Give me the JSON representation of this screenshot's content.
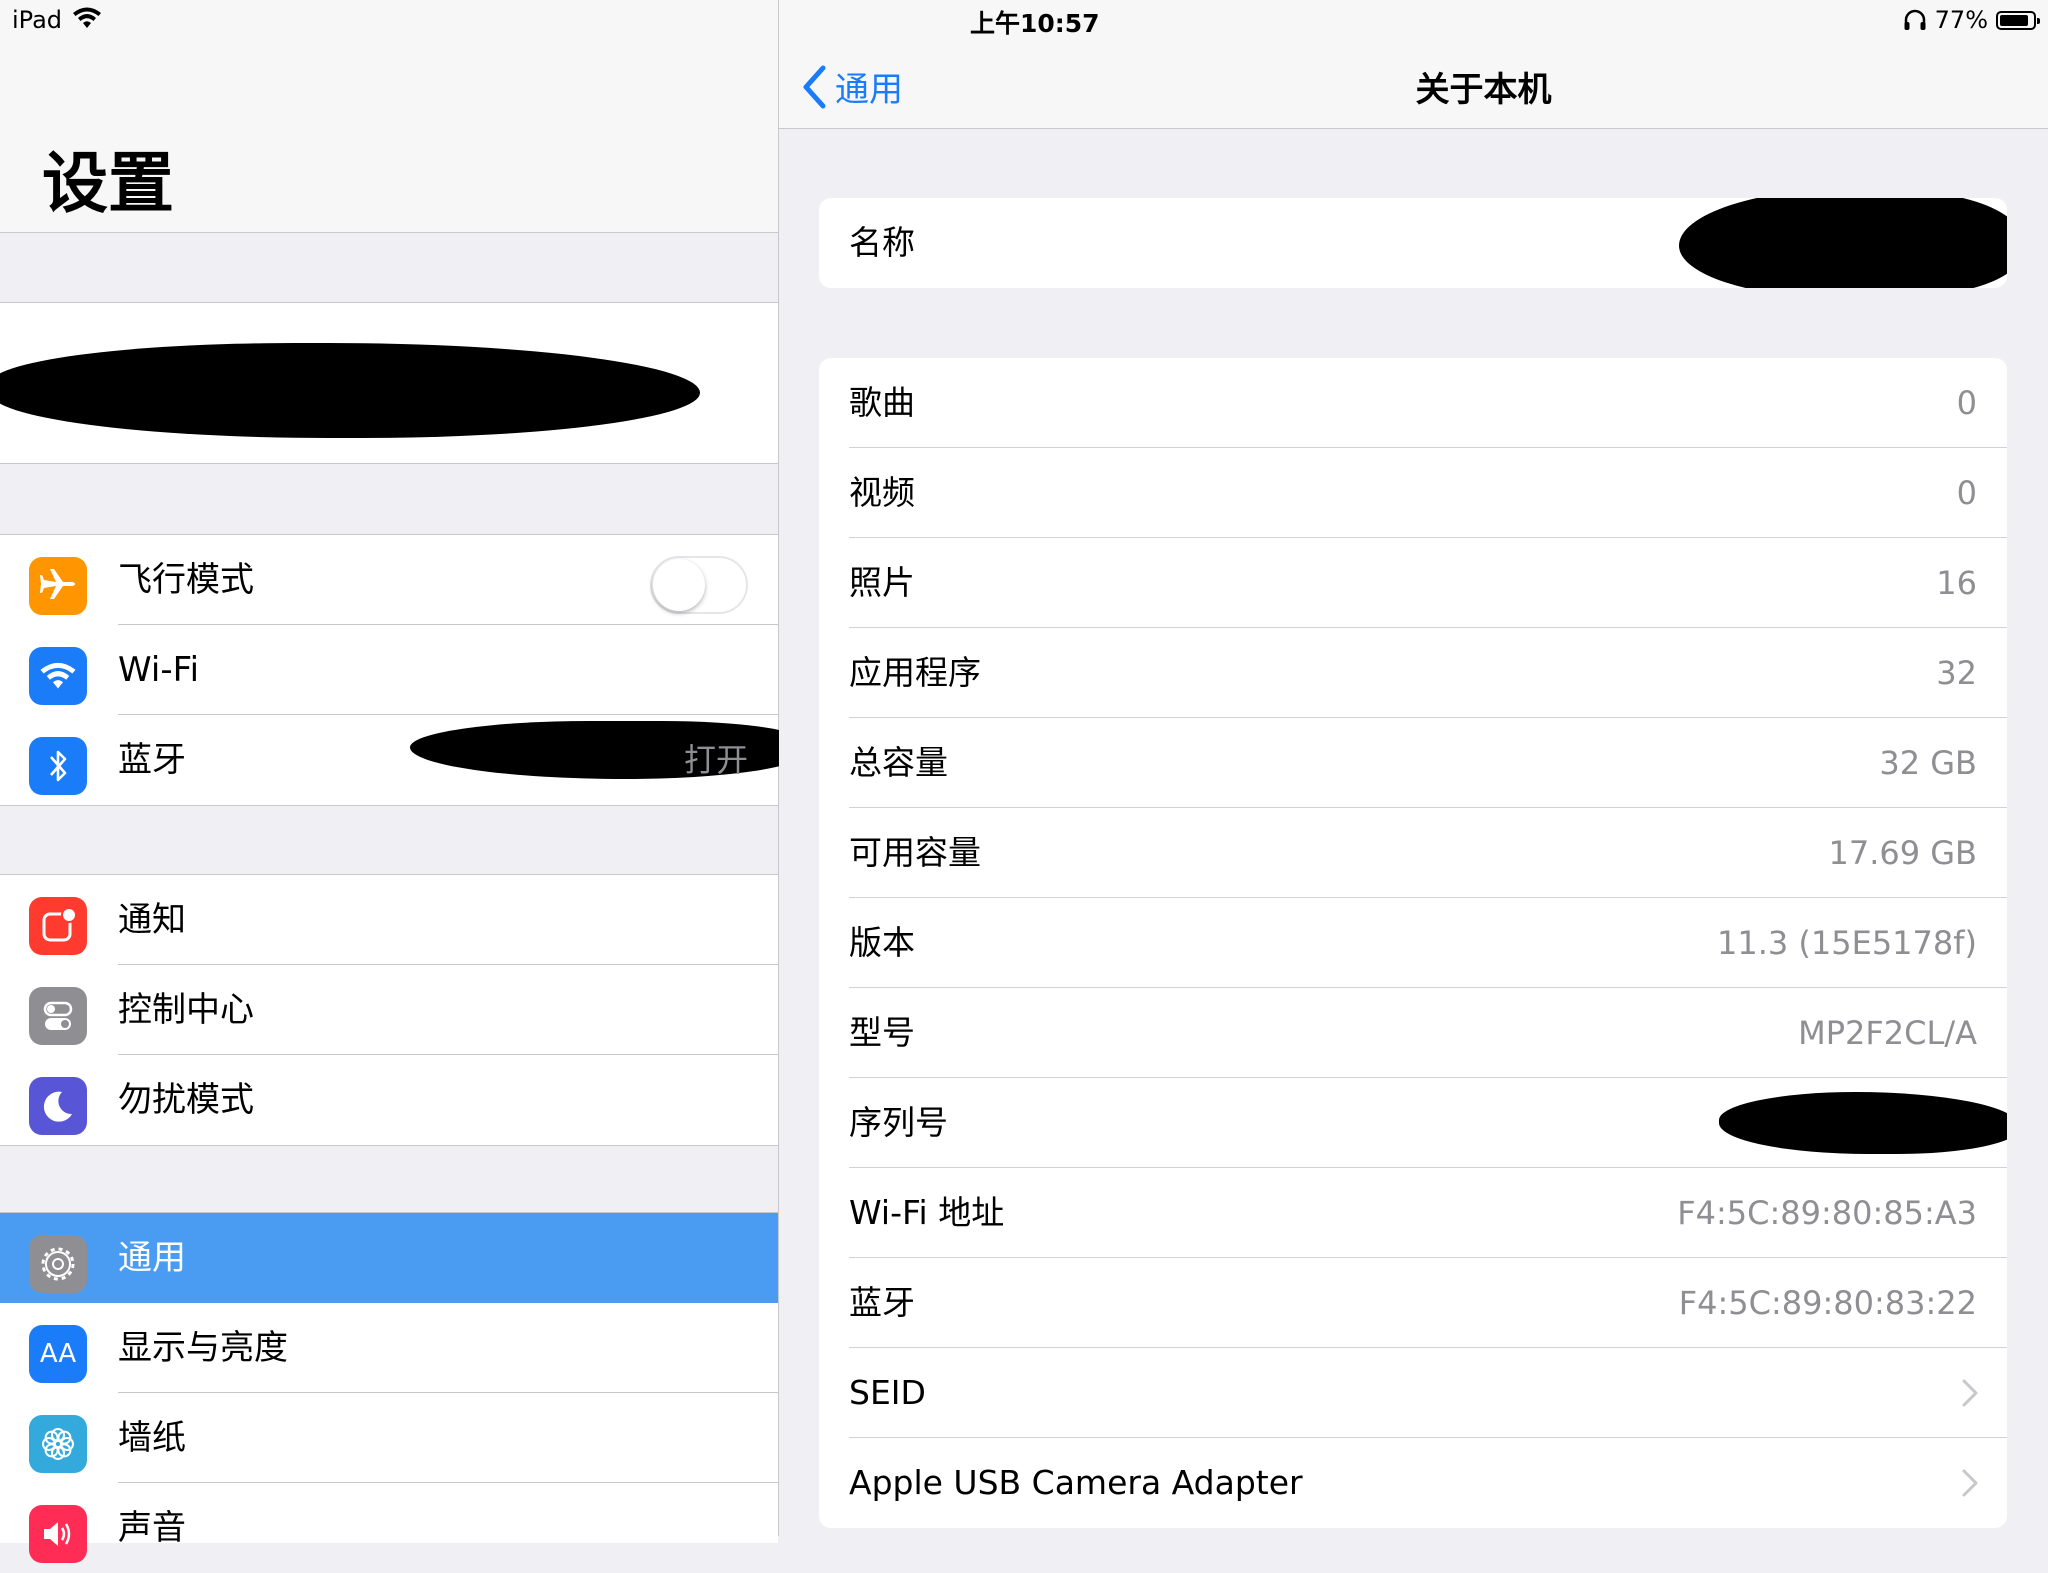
{
  "status_bar": {
    "device": "iPad",
    "time": "上午10:57",
    "battery": "77%",
    "battery_level": 0.77
  },
  "sidebar": {
    "title": "设置",
    "group1": [
      {
        "label": "飞行模式",
        "icon": "airplane-icon",
        "color": "#ff9500",
        "toggle": false
      },
      {
        "label": "Wi-Fi",
        "icon": "wifi-icon",
        "color": "#1a7cf9"
      },
      {
        "label": "蓝牙",
        "icon": "bluetooth-icon",
        "color": "#1a7cf9",
        "value": "打开"
      }
    ],
    "group2": [
      {
        "label": "通知",
        "icon": "notifications-icon",
        "color": "#ff3b30"
      },
      {
        "label": "控制中心",
        "icon": "control-center-icon",
        "color": "#8e8e93"
      },
      {
        "label": "勿扰模式",
        "icon": "moon-icon",
        "color": "#5856d6"
      }
    ],
    "group3": [
      {
        "label": "通用",
        "icon": "gear-icon",
        "color": "#8e8e93",
        "selected": true
      },
      {
        "label": "显示与亮度",
        "icon": "display-icon",
        "color": "#1a7cf9",
        "glyph": "AA"
      },
      {
        "label": "墙纸",
        "icon": "wallpaper-icon",
        "color": "#34aadc"
      },
      {
        "label": "声音",
        "icon": "sound-icon",
        "color": "#ff2d55"
      }
    ]
  },
  "detail": {
    "back_label": "通用",
    "title": "关于本机",
    "name_label": "名称",
    "rows": [
      {
        "label": "歌曲",
        "value": "0"
      },
      {
        "label": "视频",
        "value": "0"
      },
      {
        "label": "照片",
        "value": "16"
      },
      {
        "label": "应用程序",
        "value": "32"
      },
      {
        "label": "总容量",
        "value": "32 GB"
      },
      {
        "label": "可用容量",
        "value": "17.69 GB"
      },
      {
        "label": "版本",
        "value": "11.3 (15E5178f)"
      },
      {
        "label": "型号",
        "value": "MP2F2CL/A"
      },
      {
        "label": "序列号",
        "value": ""
      },
      {
        "label": "Wi-Fi 地址",
        "value": "F4:5C:89:80:85:A3"
      },
      {
        "label": "蓝牙",
        "value": "F4:5C:89:80:83:22"
      },
      {
        "label": "SEID",
        "value": "",
        "chevron": true
      },
      {
        "label": "Apple USB Camera Adapter",
        "value": "",
        "chevron": true
      }
    ]
  },
  "colors": {
    "accent": "#1a7cf9",
    "selected_row": "#4a9cf3",
    "secondary_text": "#8e8e93",
    "background": "#efeff4"
  }
}
